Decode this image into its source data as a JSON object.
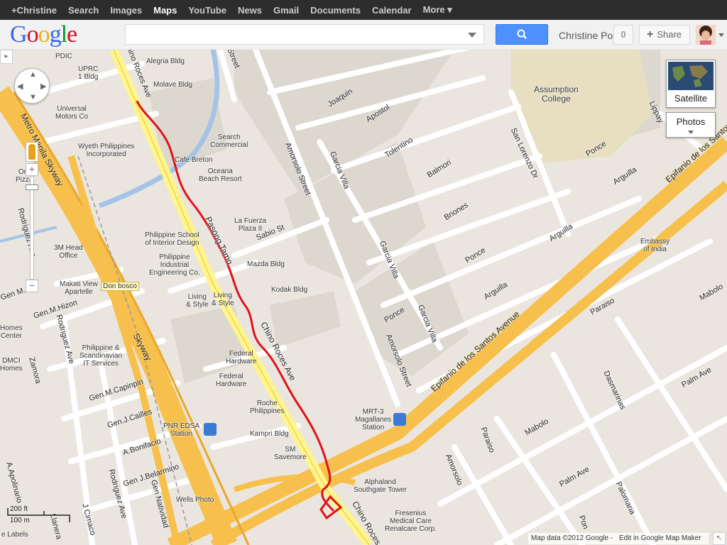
{
  "gbar": {
    "items": [
      {
        "label": "+Christine",
        "active": false
      },
      {
        "label": "Search",
        "active": false
      },
      {
        "label": "Images",
        "active": false
      },
      {
        "label": "Maps",
        "active": true
      },
      {
        "label": "YouTube",
        "active": false
      },
      {
        "label": "News",
        "active": false
      },
      {
        "label": "Gmail",
        "active": false
      },
      {
        "label": "Documents",
        "active": false
      },
      {
        "label": "Calendar",
        "active": false
      },
      {
        "label": "More ▾",
        "active": false
      }
    ]
  },
  "header": {
    "logo": "Google",
    "search_value": "",
    "search_icon": "search-icon",
    "user_name": "Christine Po",
    "notifications": "0",
    "share_label": "Share",
    "share_icon": "+"
  },
  "map_controls": {
    "zoom_in": "+",
    "zoom_out": "−",
    "satellite_label": "Satellite",
    "photos_label": "Photos",
    "side_toggle": "▸",
    "scale_ft": "200 ft",
    "scale_m": "100 m"
  },
  "attribution": {
    "map_data": "Map data ©2012 Google -",
    "edit": "Edit in Google Map Maker"
  },
  "places": {
    "pdic": "PDIC",
    "uprc": "UPRC\n1 Bldg",
    "alegria": "Alegria Bldg",
    "molave": "Molave Bldg",
    "universal": "Universal\nMotors Co",
    "wyeth": "Wyeth Philippines\nIncorporated",
    "cafe_breton": "Cafe Breton",
    "search_commercial": "Search\nCommercial",
    "oceana": "Oceana\nBeach Resort",
    "la_fuerza": "La Fuerza\nPlaza II",
    "phil_school": "Philippine School\nof Interior Design",
    "phil_industrial": "Philippine\nIndustrial\nEngineering Co.",
    "mazda": "Mazda Bldg",
    "kodak": "Kodak Bldg",
    "living1": "Living\n& Style",
    "living2": "Living\n& Style",
    "makati_view": "Makati View\nApartelle",
    "don_bosco": "Don bosco",
    "head_office": "3M Head\nOffice",
    "scandinavian": "Philippine &\nScandinavian\nIT Services",
    "federal1": "Federal\nHardware",
    "federal2": "Federal\nHardware",
    "roche": "Roche\nPhilippines",
    "kampri": "Kampri Bldg",
    "sm_savemore": "SM\nSavemore",
    "pnr": "PNR EDSA\nStation",
    "mrt": "MRT-3\nMagallanes\nStation",
    "alphaland": "Alphaland\nSouthgate Tower",
    "fresenius": "Fresenius\nMedical Care\nRenalcare Corp.",
    "wells": "Wells Photo",
    "assumption": "Assumption\nCollege",
    "embassy": "Embassy\nof India",
    "orapizza": "Ora\nPizza",
    "homes": "Homes\nCenter",
    "dmci": "DMCI\nHomes",
    "e_labels": "e Labels"
  },
  "roads": {
    "chino_roces_top": "Chino Roces Ave",
    "pasong_tamo": "Pasong Tamo",
    "chino_roces_mid": "Chino Roces Ave",
    "chino_roces_bot": "Chino Roces",
    "sabio": "Sabio St",
    "amorsolo1": "Amorsolo Street",
    "amorsolo2": "Amorsolo Street",
    "amorsolo3": "Amorsolo",
    "joaquin": "Joaquin",
    "apostol": "Apostol",
    "tolentino": "Tolentino",
    "balmori": "Balmori",
    "briones": "Briones",
    "garcia_villa1": "Garcia Villa",
    "garcia_villa2": "Garcia Villa",
    "garcia_villa3": "Garcia Villa",
    "ponce1": "Ponce",
    "ponce2": "Ponce",
    "ponce3": "Ponce",
    "arguilla1": "Arguilla",
    "arguilla2": "Arguilla",
    "arguilla3": "Arguilla",
    "san_lorenzo": "San Lorenzo Dr",
    "lippay": "Lippay",
    "edsa1": "Epifanio de los Santos Avenue",
    "edsa2": "Epifanio de los Santos",
    "skyway1": "Metro Manila Skyway",
    "skyway2": "Skyway",
    "paraiso1": "Paraiso",
    "paraiso2": "Paraiso",
    "mabolo1": "Mabolo",
    "mabolo2": "Mabolo",
    "dasmarinas": "Dasmarinas",
    "palm1": "Palm Ave",
    "palm2": "Palm Ave",
    "palomaria": "Palomaria",
    "rodriguez1": "Rodriguez Ave",
    "rodriguez2": "Rodriguez Ave",
    "rodriguez3": "Rodriguez Ave",
    "gen_hizon": "Gen.M.Hizon",
    "gen_capinpin": "Gen.M.Capinpin",
    "gen_cailles": "Gen.J.Cailles",
    "bonifacio": "A.Bonifacio",
    "belarmino": "Gen J.Belarmino",
    "natividad": "Gen Natividad",
    "apolinario": "A.Apolinario",
    "cimaco": "J Cimaco",
    "llanera": "Llanera",
    "zamora": "Zamora",
    "street_top": "Street",
    "gen_la": "Gen M. La",
    "pon_short": "Pon"
  }
}
